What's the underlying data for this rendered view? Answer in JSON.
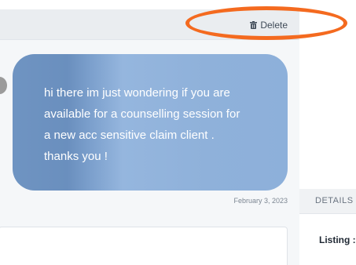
{
  "toolbar": {
    "delete_label": "Delete",
    "delete_icon": "trash-icon"
  },
  "message": {
    "lines": [
      "hi there im just wondering if you are",
      "available for a counselling session for",
      "a new acc sensitive claim client .",
      "thanks you !"
    ],
    "timestamp": "February 3, 2023"
  },
  "details": {
    "tab_label": "DETAILS",
    "listing_label": "Listing :"
  },
  "colors": {
    "highlight": "#f46a1f",
    "bubble": "#8db0da"
  }
}
